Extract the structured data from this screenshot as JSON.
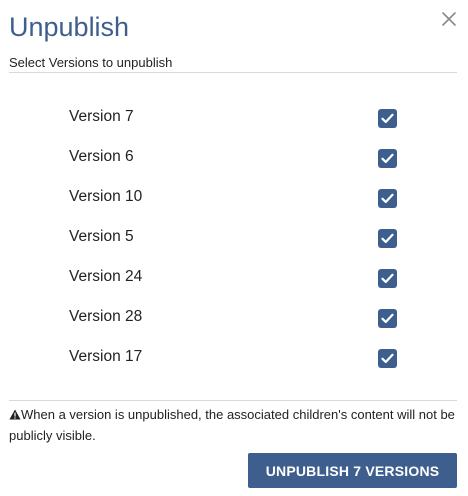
{
  "dialog": {
    "title": "Unpublish",
    "subtitle": "Select Versions to unpublish",
    "close_icon": "close-icon"
  },
  "versions": [
    {
      "label": "Version 7",
      "checked": true
    },
    {
      "label": "Version 6",
      "checked": true
    },
    {
      "label": "Version 10",
      "checked": true
    },
    {
      "label": "Version 5",
      "checked": true
    },
    {
      "label": "Version 24",
      "checked": true
    },
    {
      "label": "Version 28",
      "checked": true
    },
    {
      "label": "Version 17",
      "checked": true
    }
  ],
  "warning": {
    "icon": "warning-icon",
    "text": "When a version is unpublished, the associated children's content will not be publicly visible."
  },
  "actions": {
    "unpublish_label": "UNPUBLISH 7 VERSIONS"
  },
  "colors": {
    "accent": "#3e5f8e",
    "divider": "#d9d9d9"
  }
}
